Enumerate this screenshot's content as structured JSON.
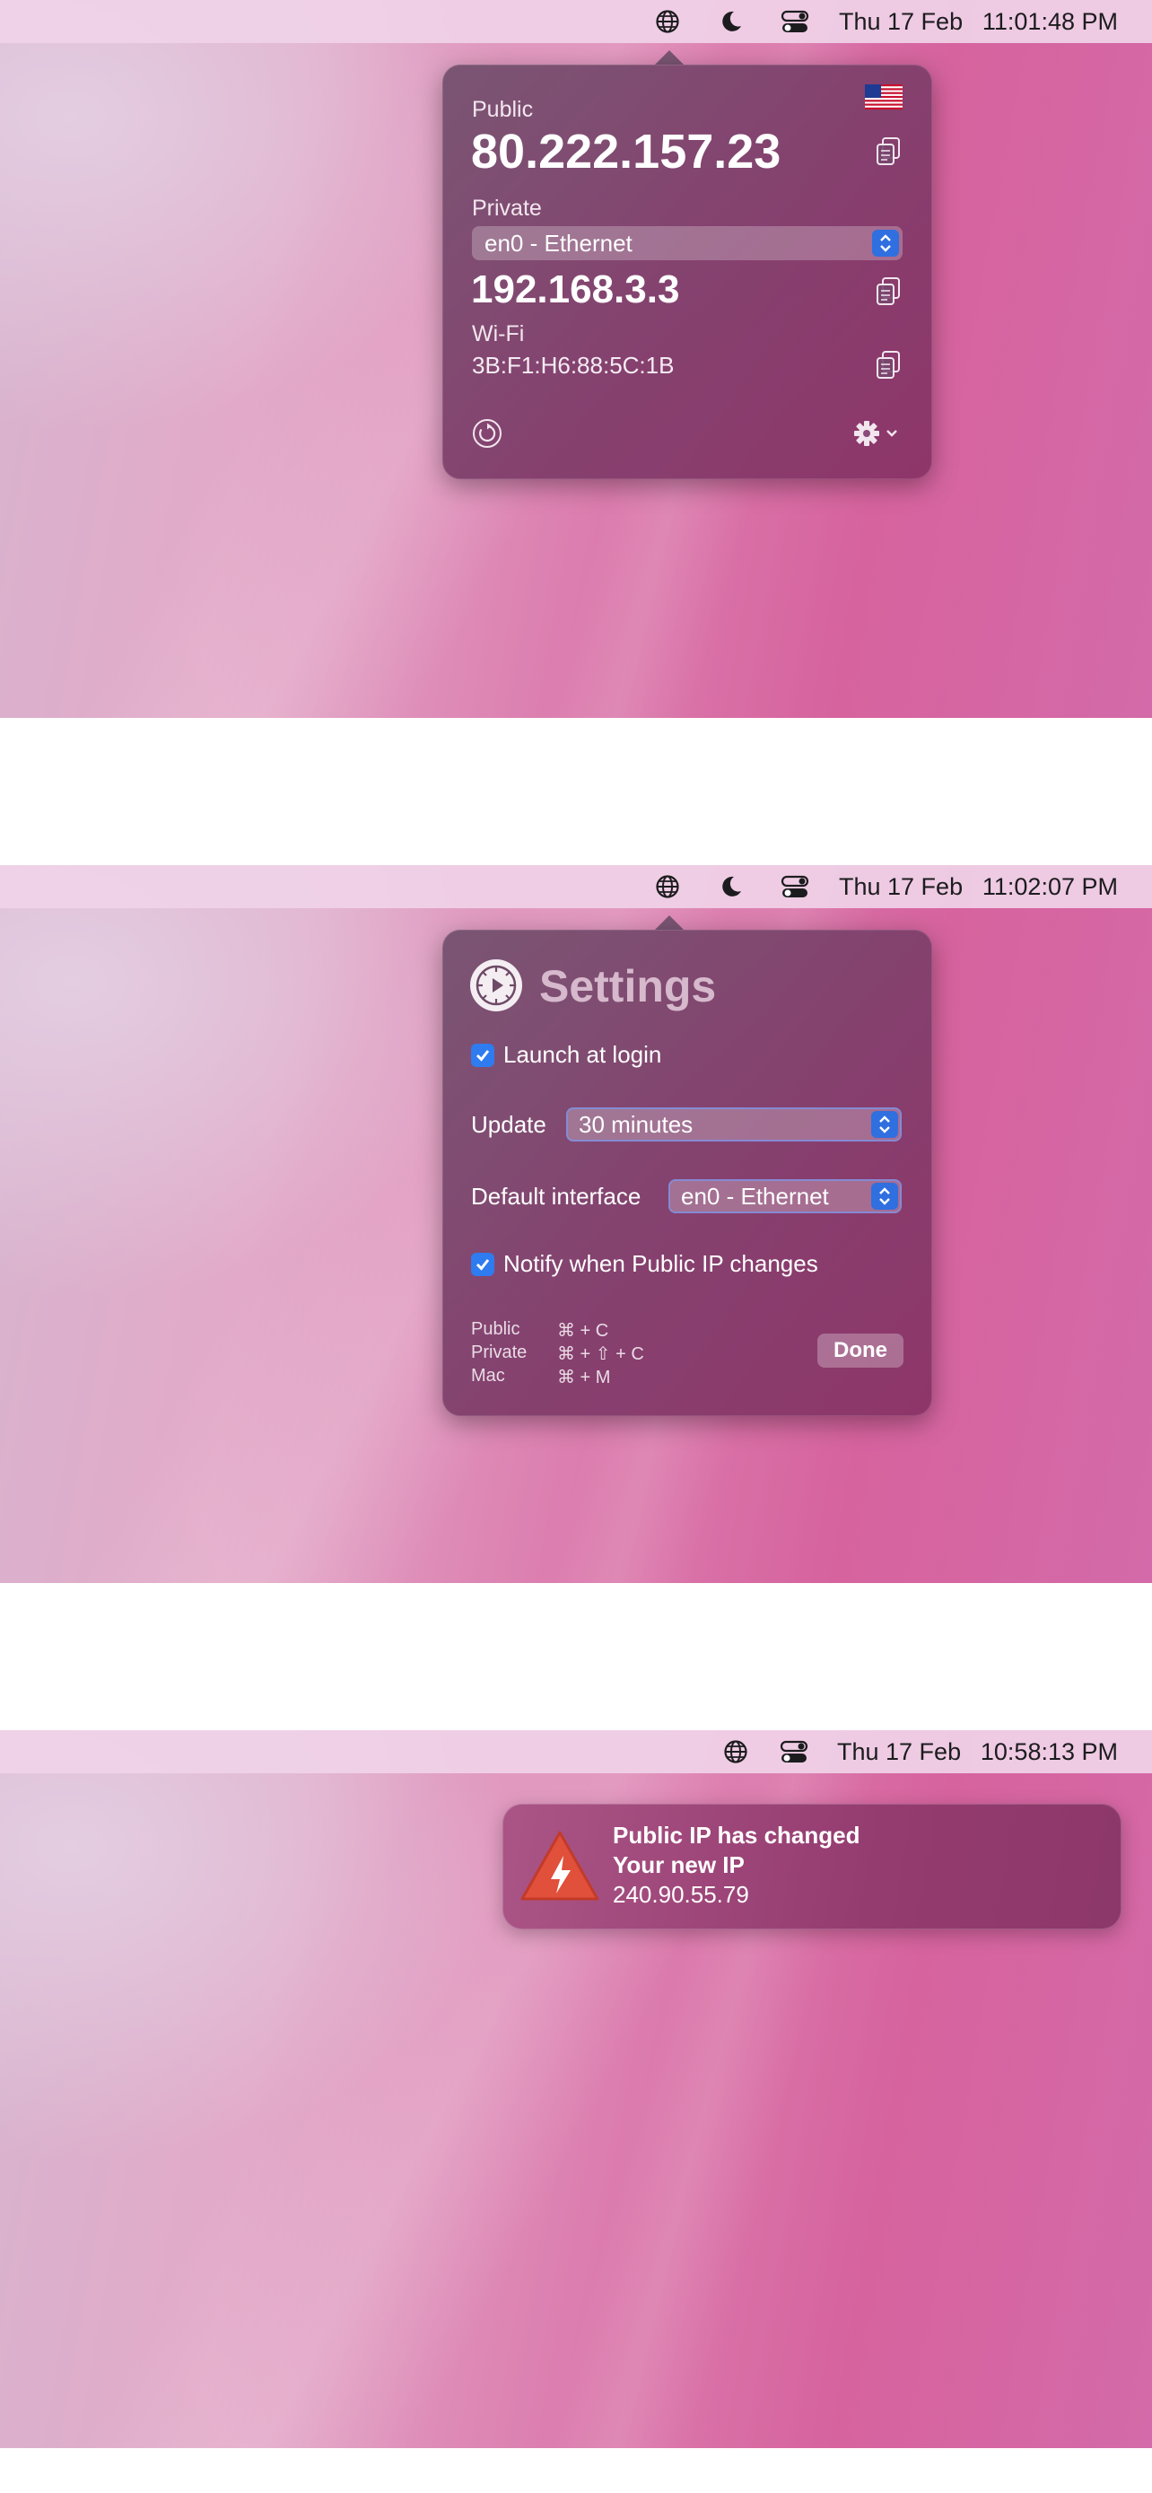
{
  "panels": [
    {
      "menubar": {
        "date": "Thu 17 Feb",
        "time": "11:01:48 PM"
      },
      "popover": {
        "public_label": "Public",
        "public_ip": "80.222.157.23",
        "flag": "us-flag-icon",
        "private_label": "Private",
        "interface": "en0 - Ethernet",
        "private_ip": "192.168.3.3",
        "wifi_label": "Wi-Fi",
        "mac": "3B:F1:H6:88:5C:1B"
      }
    },
    {
      "menubar": {
        "date": "Thu 17 Feb",
        "time": "11:02:07 PM"
      },
      "settings": {
        "title": "Settings",
        "launch_at_login": "Launch at login",
        "launch_checked": true,
        "update_label": "Update",
        "update_value": "30  minutes",
        "interface_label": "Default interface",
        "interface_value": "en0 - Ethernet",
        "notify_label": "Notify when Public IP changes",
        "notify_checked": true,
        "shortcuts": [
          {
            "name": "Public",
            "keys": "⌘ + C"
          },
          {
            "name": "Private",
            "keys": "⌘ + ⇧ + C"
          },
          {
            "name": "Mac",
            "keys": "⌘ + M"
          }
        ],
        "done_label": "Done"
      }
    },
    {
      "menubar": {
        "date": "Thu 17 Feb",
        "time": "10:58:13 PM"
      },
      "notification": {
        "title": "Public IP has changed",
        "subtitle": "Your new IP",
        "ip": "240.90.55.79"
      }
    }
  ]
}
